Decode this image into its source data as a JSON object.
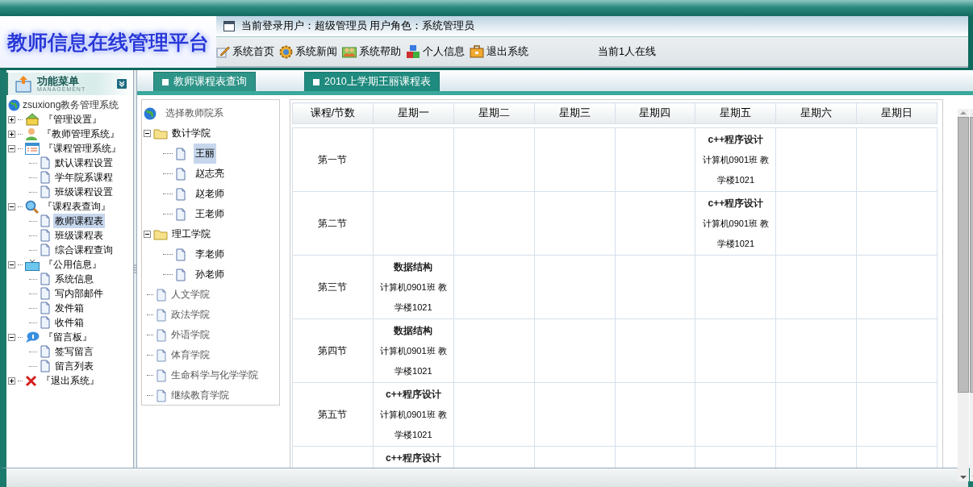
{
  "header": {
    "title": "教师信息在线管理平台",
    "user_info": "当前登录用户：超级管理员  用户角色：系统管理员",
    "nav": [
      {
        "label": "系统首页"
      },
      {
        "label": "系统新闻"
      },
      {
        "label": "系统帮助"
      },
      {
        "label": "个人信息"
      },
      {
        "label": "退出系统"
      }
    ],
    "online": "当前1人在线"
  },
  "sidebar": {
    "title": "功能菜单",
    "subtitle": "MANAGEMENT",
    "root": "zsuxiong教务管理系统",
    "items": [
      {
        "label": "『管理设置』",
        "expanded": false
      },
      {
        "label": "『教师管理系统』",
        "expanded": false
      },
      {
        "label": "『课程管理系统』",
        "expanded": true,
        "children": [
          {
            "label": "默认课程设置",
            "selected": false
          },
          {
            "label": "学年院系课程",
            "selected": false
          },
          {
            "label": "班级课程设置",
            "selected": false
          }
        ]
      },
      {
        "label": "『课程表查询』",
        "expanded": true,
        "children": [
          {
            "label": "教师课程表",
            "selected": true
          },
          {
            "label": "班级课程表",
            "selected": false
          },
          {
            "label": "综合课程查询",
            "selected": false
          }
        ]
      },
      {
        "label": "『公用信息』",
        "expanded": true,
        "children": [
          {
            "label": "系统信息",
            "selected": false
          },
          {
            "label": "写内部邮件",
            "selected": false
          },
          {
            "label": "发件箱",
            "selected": false
          },
          {
            "label": "收件箱",
            "selected": false
          }
        ]
      },
      {
        "label": "『留言板』",
        "expanded": true,
        "children": [
          {
            "label": "签写留言",
            "selected": false
          },
          {
            "label": "留言列表",
            "selected": false
          }
        ]
      },
      {
        "label": "『退出系统』",
        "expanded": false
      }
    ]
  },
  "tabs": [
    {
      "label": "教师课程表查询",
      "selected": false
    },
    {
      "label": "2010上学期王丽课程表",
      "selected": true
    }
  ],
  "department_tree": {
    "root": "选择教师院系",
    "items": [
      {
        "kind": "folder",
        "label": "数计学院",
        "expanded": true,
        "children": [
          {
            "label": "王丽",
            "selected": true
          },
          {
            "label": "赵志亮",
            "selected": false
          },
          {
            "label": "赵老师",
            "selected": false
          },
          {
            "label": "王老师",
            "selected": false
          }
        ]
      },
      {
        "kind": "folder",
        "label": "理工学院",
        "expanded": true,
        "children": [
          {
            "label": "李老师",
            "selected": false
          },
          {
            "label": "孙老师",
            "selected": false
          }
        ]
      },
      {
        "kind": "leaf",
        "label": "人文学院"
      },
      {
        "kind": "leaf",
        "label": "政法学院"
      },
      {
        "kind": "leaf",
        "label": "外语学院"
      },
      {
        "kind": "leaf",
        "label": "体育学院"
      },
      {
        "kind": "leaf",
        "label": "生命科学与化学学院"
      },
      {
        "kind": "leaf",
        "label": "继续教育学院"
      }
    ]
  },
  "timetable": {
    "columns": [
      "课程/节数",
      "星期一",
      "星期二",
      "星期三",
      "星期四",
      "星期五",
      "星期六",
      "星期日"
    ],
    "rows": [
      {
        "label": "第一节",
        "cells": [
          null,
          null,
          null,
          null,
          {
            "course": "c++程序设计",
            "detail": "计算机0901班 教学楼1021"
          },
          null,
          null
        ]
      },
      {
        "label": "第二节",
        "cells": [
          null,
          null,
          null,
          null,
          {
            "course": "c++程序设计",
            "detail": "计算机0901班 教学楼1021"
          },
          null,
          null
        ]
      },
      {
        "label": "第三节",
        "cells": [
          {
            "course": "数据结构",
            "detail": "计算机0901班 教学楼1021"
          },
          null,
          null,
          null,
          null,
          null,
          null
        ]
      },
      {
        "label": "第四节",
        "cells": [
          {
            "course": "数据结构",
            "detail": "计算机0901班 教学楼1021"
          },
          null,
          null,
          null,
          null,
          null,
          null
        ]
      },
      {
        "label": "第五节",
        "cells": [
          {
            "course": "c++程序设计",
            "detail": "计算机0901班 教学楼1021"
          },
          null,
          null,
          null,
          null,
          null,
          null
        ]
      },
      {
        "cells": [
          {
            "course": "c++程序设计"
          },
          null,
          null,
          null,
          null,
          null,
          null
        ]
      }
    ]
  }
}
